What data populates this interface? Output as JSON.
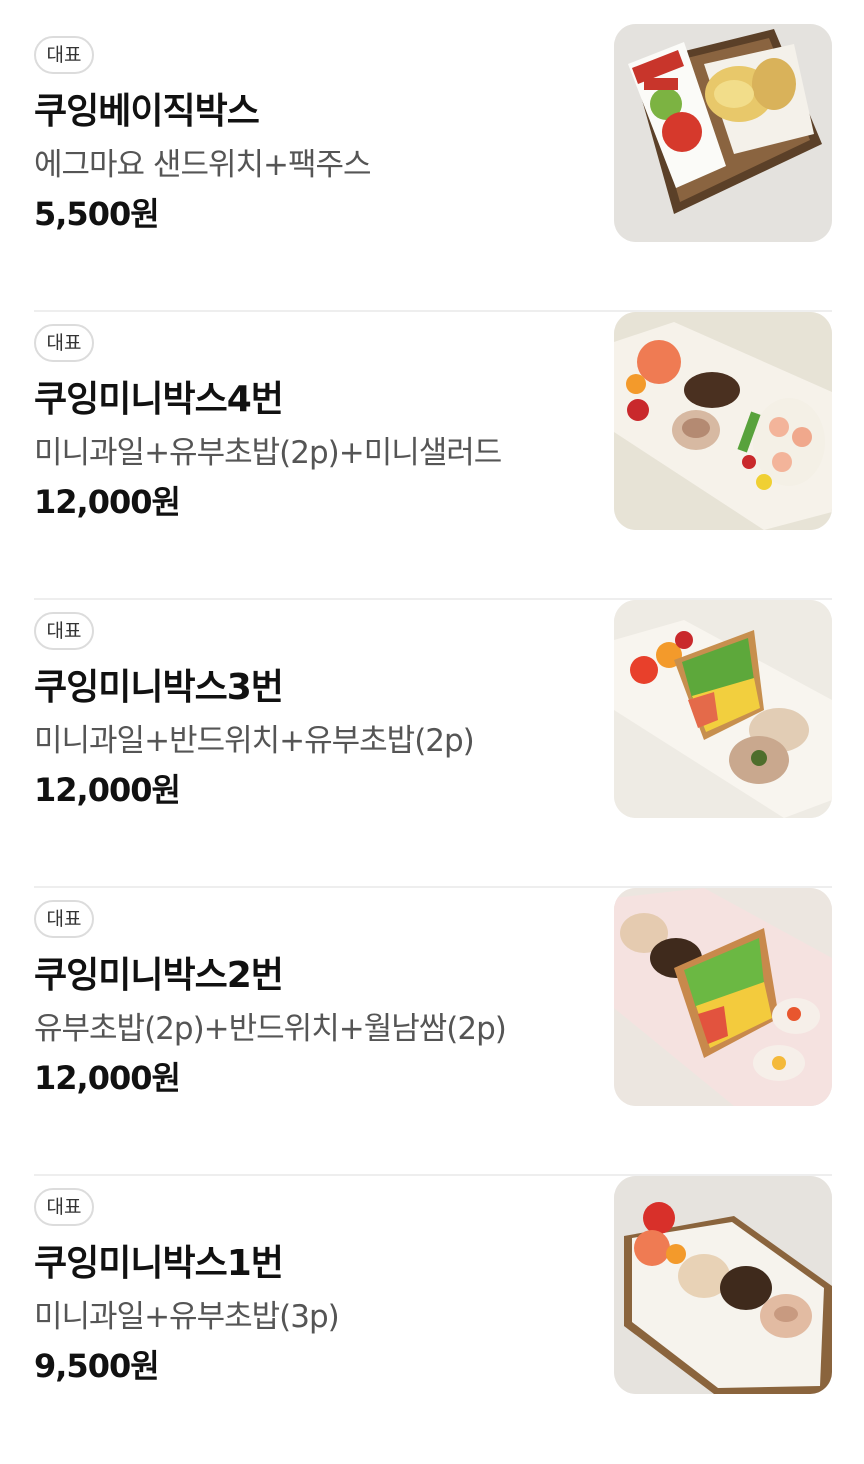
{
  "menu": {
    "items": [
      {
        "badge": "대표",
        "name": "쿠잉베이직박스",
        "description": "에그마요 샌드위치+팩주스",
        "price": "5,500원",
        "image": "sandwich-and-apple-juice-photo"
      },
      {
        "badge": "대표",
        "name": "쿠잉미니박스4번",
        "description": "미니과일+유부초밥(2p)+미니샐러드",
        "price": "12,000원",
        "image": "fruit-inari-salad-box-photo"
      },
      {
        "badge": "대표",
        "name": "쿠잉미니박스3번",
        "description": "미니과일+반드위치+유부초밥(2p)",
        "price": "12,000원",
        "image": "fruit-sandwich-inari-box-photo"
      },
      {
        "badge": "대표",
        "name": "쿠잉미니박스2번",
        "description": "유부초밥(2p)+반드위치+월남쌈(2p)",
        "price": "12,000원",
        "image": "inari-sandwich-springroll-box-photo"
      },
      {
        "badge": "대표",
        "name": "쿠잉미니박스1번",
        "description": "미니과일+유부초밥(3p)",
        "price": "9,500원",
        "image": "fruit-inari-box-photo"
      }
    ]
  }
}
